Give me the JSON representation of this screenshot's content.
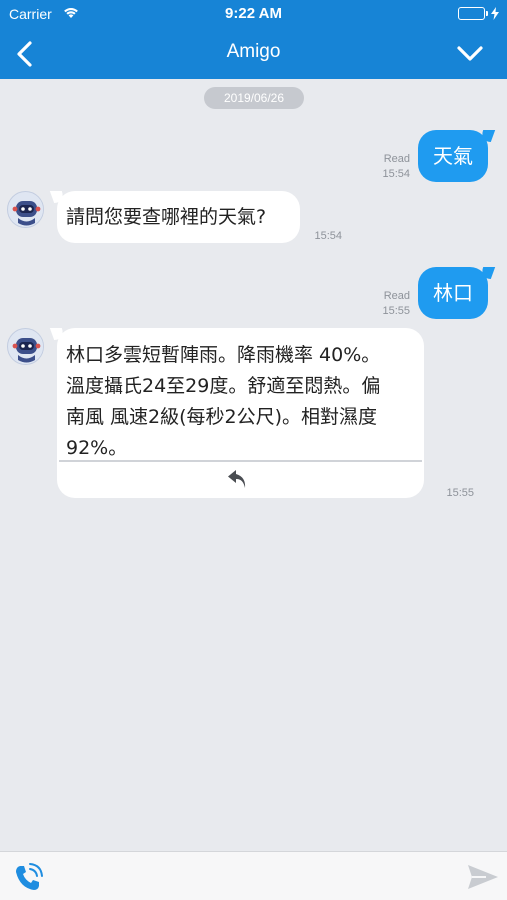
{
  "status_bar": {
    "carrier": "Carrier",
    "time": "9:22 AM"
  },
  "nav": {
    "title": "Amigo",
    "back_icon": "chevron-left-icon",
    "collapse_icon": "chevron-down-icon"
  },
  "chat": {
    "date": "2019/06/26",
    "messages": [
      {
        "from": "user",
        "text": "天氣",
        "read": "Read",
        "time": "15:54"
      },
      {
        "from": "bot",
        "text": "請問您要查哪裡的天氣?",
        "time": "15:54"
      },
      {
        "from": "user",
        "text": "林口",
        "read": "Read",
        "time": "15:55"
      },
      {
        "from": "bot",
        "lines": [
          "林口多雲短暫陣雨。降雨機率 40%。",
          "溫度攝氏24至29度。舒適至悶熱。偏",
          "南風 風速2級(每秒2公尺)。相對濕度",
          "92%。"
        ],
        "time": "15:55"
      }
    ]
  },
  "composer": {
    "input_value": "",
    "placeholder": ""
  },
  "colors": {
    "header": "#1784d6",
    "user_bubble": "#1f9bf0",
    "background": "#e8eaee"
  }
}
